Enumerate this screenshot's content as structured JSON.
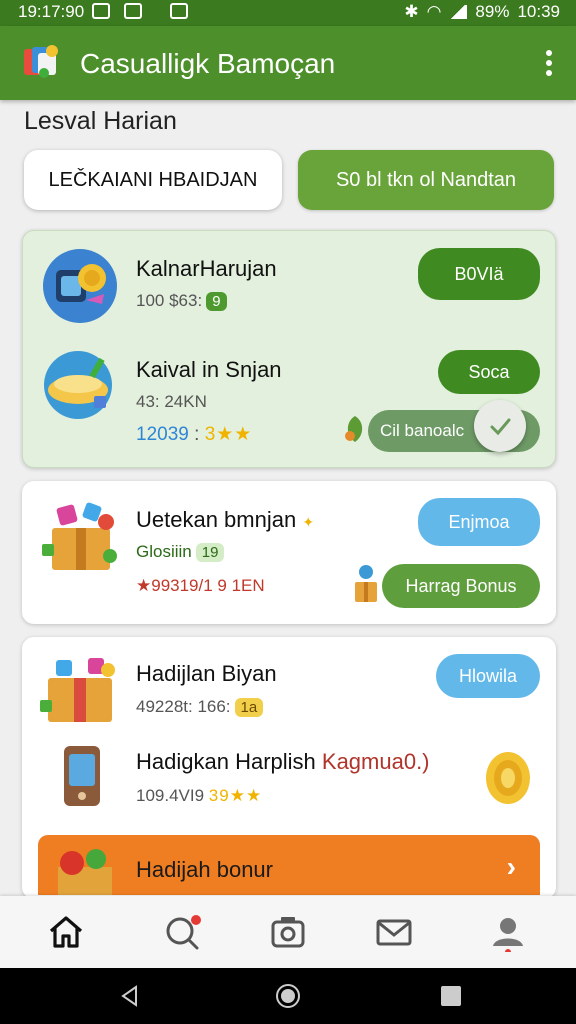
{
  "status_bar": {
    "time_left": "19:17:90",
    "battery": "89%",
    "time_right": "10:39"
  },
  "app": {
    "title": "Casualligk Bamoçan"
  },
  "page": {
    "title": "Lesval Harian"
  },
  "tabs": [
    {
      "label": "LEČKAIANI HBAIDJAN",
      "selected": false
    },
    {
      "label": "S0 bl tkn ol Nandtan",
      "selected": true
    }
  ],
  "card1": {
    "item1": {
      "title": "KalnarHarujan",
      "sub": "100 $63:",
      "chip": "9",
      "button": "B0VIä"
    },
    "item2": {
      "title": "Kaival in Snjan",
      "sub": "43: 24KN",
      "score": "12039",
      "score_sep": ":",
      "stars": "3★★",
      "button": "Soca"
    },
    "toggle_label": "Cil banoalc"
  },
  "card2": {
    "title": "Uetekan bmnjan",
    "sub": "Glosiiin",
    "chip": "19",
    "progress": "★99319/1 9 1EN",
    "button": "Enjmoa",
    "bonus_button": "Harrag Bonus"
  },
  "card3": {
    "item1": {
      "title": "Hadijlan Biyan",
      "sub": "49228t: 166:",
      "chip": "1a",
      "button": "Hlowila"
    },
    "item2": {
      "title": "Hadigkan Harplish",
      "title_accent": "Kagmua0.)",
      "sub": "109.4VI9",
      "stars": "39★★"
    }
  },
  "banner": {
    "label": "Hadijah bonur"
  },
  "colors": {
    "primary": "#4d8f2b",
    "accent_orange": "#ef7d22",
    "accent_blue": "#63b8ea",
    "card_green": "#e3f0dd"
  },
  "icons": [
    "home-icon",
    "search-icon",
    "camera-icon",
    "mail-icon",
    "profile-icon"
  ]
}
